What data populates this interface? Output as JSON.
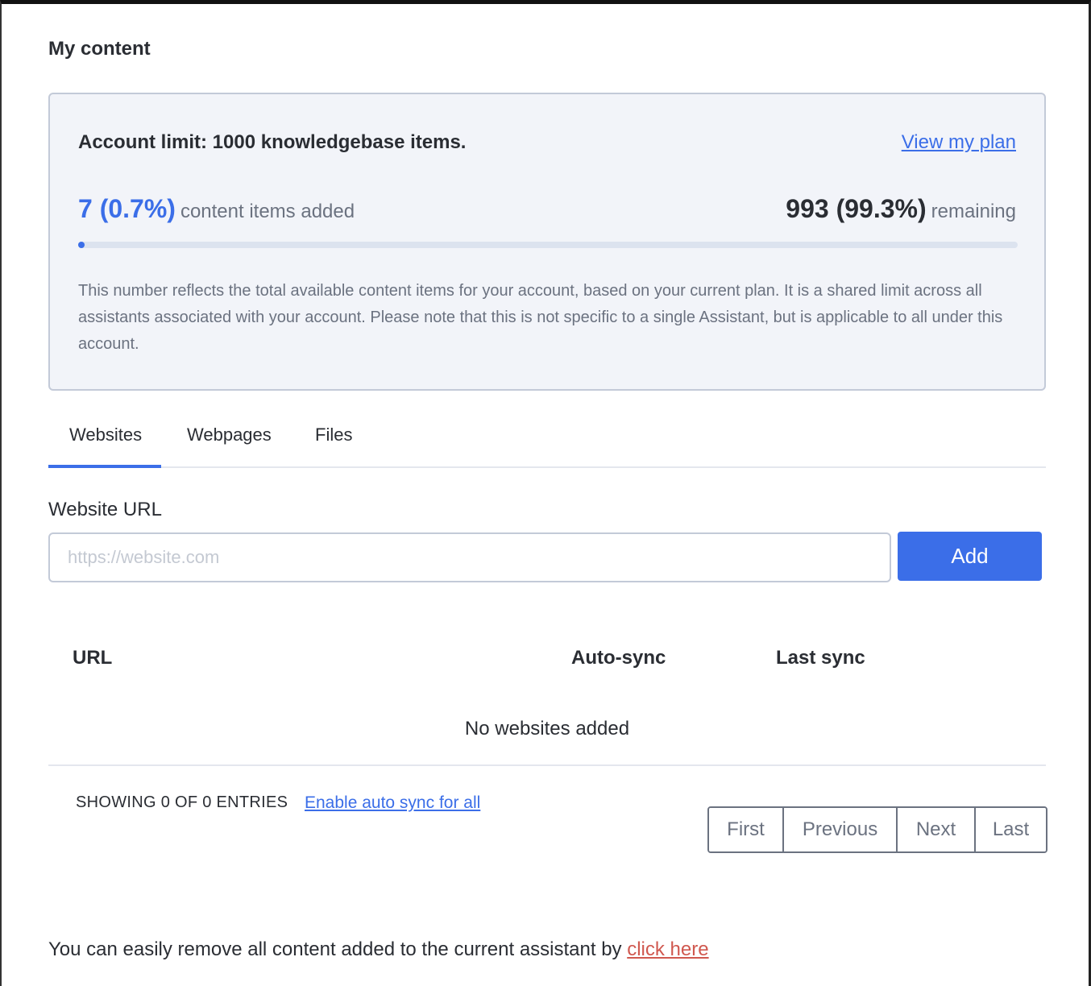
{
  "page": {
    "title": "My content"
  },
  "limit_card": {
    "title": "Account limit: 1000 knowledgebase items.",
    "view_plan_link": "View my plan",
    "used_value": "7 (0.7%)",
    "used_label": "content items added",
    "remaining_value": "993 (99.3%)",
    "remaining_label": "remaining",
    "progress_fraction": 0.007,
    "description": "This number reflects the total available content items for your account, based on your current plan. It is a shared limit across all assistants associated with your account. Please note that this is not specific to a single Assistant, but is applicable to all under this account."
  },
  "tabs": [
    {
      "label": "Websites",
      "active": true
    },
    {
      "label": "Webpages",
      "active": false
    },
    {
      "label": "Files",
      "active": false
    }
  ],
  "form": {
    "label": "Website URL",
    "value": "",
    "placeholder": "https://website.com",
    "add_button": "Add"
  },
  "table": {
    "columns": [
      "URL",
      "Auto-sync",
      "Last sync"
    ],
    "rows": [],
    "empty_message": "No websites added",
    "showing_text": "SHOWING 0 OF 0 ENTRIES",
    "enable_sync_link": "Enable auto sync for all"
  },
  "pagination": {
    "first": "First",
    "previous": "Previous",
    "next": "Next",
    "last": "Last"
  },
  "footer": {
    "text": "You can easily remove all content added to the current assistant by",
    "link": "click here"
  },
  "colors": {
    "accent": "#3b6ee8",
    "danger_link": "#d0584f",
    "card_background": "#f2f4f9"
  }
}
